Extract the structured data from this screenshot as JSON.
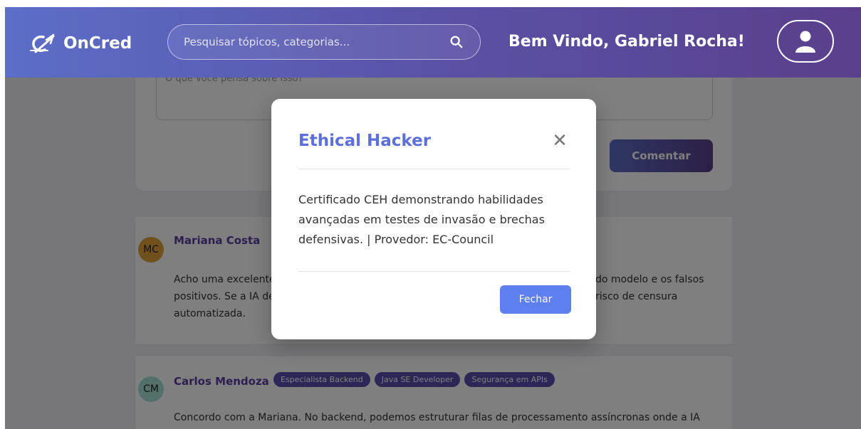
{
  "header": {
    "brand": "OnCred",
    "search_placeholder": "Pesquisar tópicos, categorias...",
    "welcome": "Bem Vindo, Gabriel Rocha!"
  },
  "comment_form": {
    "placeholder": "O que você pensa sobre isso?",
    "submit_label": "Comentar"
  },
  "comments": [
    {
      "initials": "MC",
      "name": "Mariana Costa",
      "text_line1": "Acho uma excelente",
      "text_line1_right": "do modelo e os falsos",
      "text_line2": "positivos. Se a IA de",
      "text_line2_right": "risco de censura",
      "text_line3": "automatizada."
    },
    {
      "initials": "CM",
      "name": "Carlos Mendoza",
      "tags": [
        "Especialista Backend",
        "Java SE Developer",
        "Segurança em APIs"
      ],
      "text": "Concordo com a Mariana. No backend, podemos estruturar filas de processamento assíncronas onde a IA"
    }
  ],
  "modal": {
    "title": "Ethical Hacker",
    "body": "Certificado CEH demonstrando habilidades avançadas em testes de invasão e brechas defensivas. | Provedor: EC-Council",
    "close_label": "Fechar"
  },
  "colors": {
    "header_start": "#5c6ec8",
    "header_end": "#5a3f8c",
    "modal_title": "#5d6fd9",
    "modal_button": "#5d7ff0",
    "tag_bg": "#5a4fb0"
  }
}
